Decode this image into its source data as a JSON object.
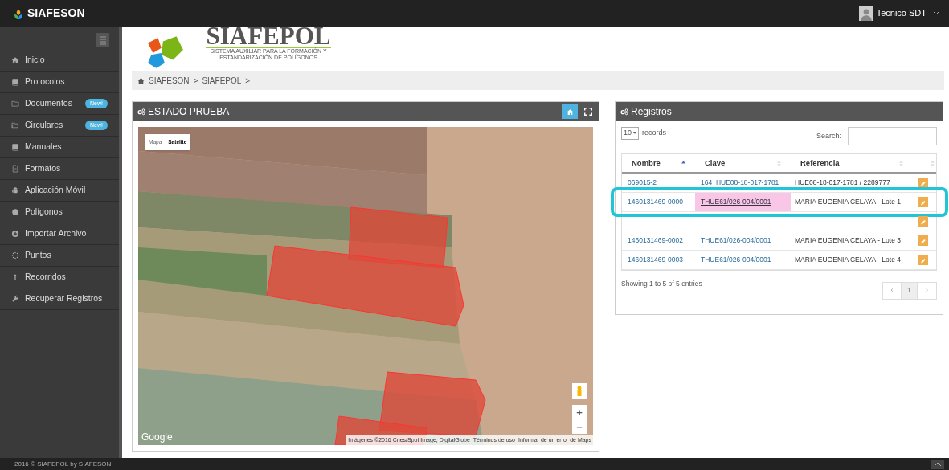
{
  "topbar": {
    "brand": "SIAFESON",
    "user": "Tecnico SDT"
  },
  "sidebar": {
    "items": [
      {
        "label": "Inicio"
      },
      {
        "label": "Protocolos"
      },
      {
        "label": "Documentos",
        "badge": "New!"
      },
      {
        "label": "Circulares",
        "badge": "New!"
      },
      {
        "label": "Manuales"
      },
      {
        "label": "Formatos"
      },
      {
        "label": "Aplicación Móvil"
      },
      {
        "label": "Polígonos"
      },
      {
        "label": "Importar Archivo"
      },
      {
        "label": "Puntos"
      },
      {
        "label": "Recorridos"
      },
      {
        "label": "Recuperar Registros"
      }
    ]
  },
  "logo": {
    "title": "SIAFEPOL",
    "subtitle": "SISTEMA AUXILIAR PARA LA FORMACIÓN Y ESTANDARIZACIÓN DE POLÍGONOS"
  },
  "breadcrumb": [
    "SIAFESON",
    ">",
    "SIAFEPOL",
    ">"
  ],
  "map_panel": {
    "title": "ESTADO PRUEBA",
    "map_types": [
      {
        "label": "Mapa",
        "selected": false
      },
      {
        "label": "Satélite",
        "selected": true
      }
    ],
    "zoom_in": "+",
    "zoom_out": "−",
    "provider": "Google",
    "attribution": [
      "Imágenes ©2016 Cnes/Spot Image, DigitalGlobe",
      "Términos de uso",
      "Informar de un error de Maps"
    ]
  },
  "records_panel": {
    "title": "Registros",
    "page_size": "10",
    "page_size_label": "records",
    "search_label": "Search:",
    "columns": [
      {
        "label": "Nombre",
        "sorted": true
      },
      {
        "label": "Clave",
        "sorted": false
      },
      {
        "label": "Referencia",
        "sorted": false
      }
    ],
    "rows": [
      {
        "nombre": "069015-2",
        "clave": "164_HUE08-18-017-1781",
        "referencia": "HUE08-18-017-1781 / 2289777",
        "clave_highlighted": false,
        "outlined": false
      },
      {
        "nombre": "1460131469-0000",
        "clave": "THUE61/026-004/0001",
        "referencia": "MARIA EUGENIA CELAYA - Lote 1",
        "clave_highlighted": true,
        "outlined": true
      },
      {
        "clave_highlighted": false,
        "outlined": false
      },
      {
        "nombre": "1460131469-0002",
        "clave": "THUE61/026-004/0001",
        "referencia": "MARIA EUGENIA CELAYA - Lote 3",
        "clave_highlighted": false,
        "outlined": false
      },
      {
        "nombre": "1460131469-0003",
        "clave": "THUE61/026-004/0001",
        "referencia": "MARIA EUGENIA CELAYA - Lote 4",
        "clave_highlighted": false,
        "outlined": false
      }
    ],
    "info": "Showing 1 to 5 of 5 entries",
    "pagination": {
      "prev": "‹",
      "pages": [
        {
          "label": "1",
          "selected": true
        }
      ],
      "next": "›"
    }
  },
  "footer": "2016 © SIAFEPOL by SIAFESON"
}
